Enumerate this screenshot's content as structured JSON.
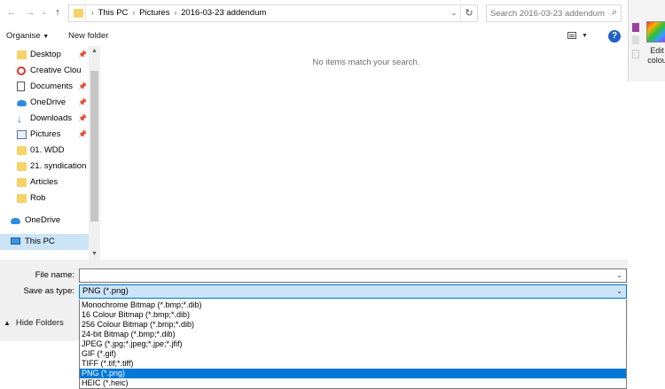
{
  "address": {
    "crumbs": [
      "This PC",
      "Pictures",
      "2016-03-23 addendum"
    ]
  },
  "search": {
    "placeholder": "Search 2016-03-23 addendum"
  },
  "toolbar": {
    "organise": "Organise",
    "new_folder": "New folder",
    "help": "?"
  },
  "nav": {
    "items": [
      {
        "label": "Desktop",
        "icon": "desktop-folder-icon"
      },
      {
        "label": "Creative Clou",
        "icon": "creative-cloud-icon"
      },
      {
        "label": "Documents",
        "icon": "documents-icon"
      },
      {
        "label": "OneDrive",
        "icon": "onedrive-icon"
      },
      {
        "label": "Downloads",
        "icon": "downloads-icon"
      },
      {
        "label": "Pictures",
        "icon": "pictures-icon"
      },
      {
        "label": "01. WDD",
        "icon": "folder-icon"
      },
      {
        "label": "21. syndication",
        "icon": "folder-icon"
      },
      {
        "label": "Articles",
        "icon": "folder-icon"
      },
      {
        "label": "Rob",
        "icon": "folder-icon"
      }
    ],
    "onedrive": "OneDrive",
    "this_pc": "This PC"
  },
  "content": {
    "empty_message": "No items match your search."
  },
  "form": {
    "file_name_label": "File name:",
    "file_name_value": "",
    "save_type_label": "Save as type:",
    "save_type_value": "PNG (*.png)",
    "hide_folders": "Hide Folders"
  },
  "save_type_options": [
    "Monochrome Bitmap (*.bmp;*.dib)",
    "16 Colour Bitmap (*.bmp;*.dib)",
    "256 Colour Bitmap (*.bmp;*.dib)",
    "24-bit Bitmap (*.bmp;*.dib)",
    "JPEG (*.jpg;*.jpeg;*.jpe;*.jfif)",
    "GIF (*.gif)",
    "TIFF (*.tif;*.tiff)",
    "PNG (*.png)",
    "HEIC (*.heic)"
  ],
  "selected_option_index": 7,
  "background_app": {
    "edit_colours": "Edit colou"
  },
  "colors": {
    "accent": "#0078d7",
    "selection_bg": "#cce4f7",
    "folder": "#f6d36a"
  }
}
